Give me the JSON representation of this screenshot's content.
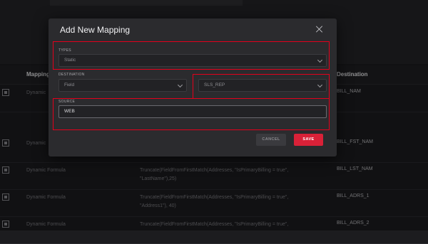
{
  "table": {
    "headers": {
      "mapping": "Mapping",
      "destination": "Destination"
    },
    "rows": [
      {
        "mapping": "Dynamic",
        "source": "",
        "source2": "",
        "destination": "BILL_NAM"
      },
      {
        "mapping": "Dynamic",
        "source": "",
        "source2": "",
        "destination": "BILL_FST_NAM"
      },
      {
        "mapping": "Dynamic Formula",
        "source": "Truncate(FieldFromFirstMatch(Addresses, \"IsPrimaryBilling = true\",",
        "source2": "\"LastName\"),25)",
        "destination": "BILL_LST_NAM"
      },
      {
        "mapping": "Dynamic Formula",
        "source": "Truncate(FieldFromFirstMatch(Addresses, \"IsPrimaryBilling = true\",",
        "source2": "\"Address1\"), 40)",
        "destination": "BILL_ADRS_1"
      },
      {
        "mapping": "Dynamic Formula",
        "source": "Truncate(FieldFromFirstMatch(Addresses, \"IsPrimaryBilling = true\",",
        "source2": "",
        "destination": "BILL_ADRS_2"
      }
    ]
  },
  "modal": {
    "title": "Add New Mapping",
    "types_label": "TYPES",
    "types_value": "Static",
    "destination_label": "DESTINATION",
    "destination_type_value": "Field",
    "destination_field_value": "SLS_REP",
    "source_label": "SOURCE",
    "source_value": "WEB",
    "cancel_label": "CANCEL",
    "save_label": "SAVE"
  },
  "colors": {
    "highlight": "#e4001b",
    "save": "#d92138",
    "modal_bg": "#2b2b2e"
  },
  "icons": {
    "close": "close-icon",
    "chevron": "chevron-down-icon",
    "row": "mapping-row-icon"
  }
}
